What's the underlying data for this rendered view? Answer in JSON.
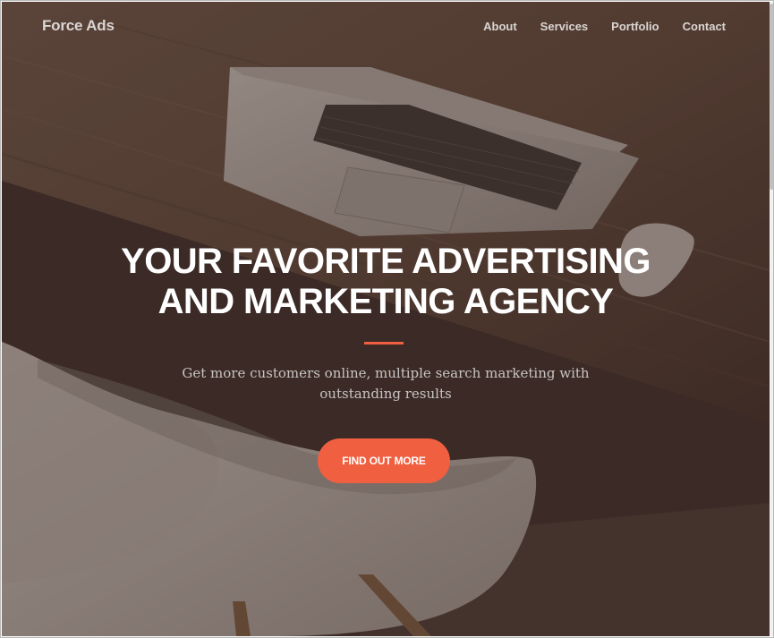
{
  "navbar": {
    "brand": "Force Ads",
    "links": [
      "About",
      "Services",
      "Portfolio",
      "Contact"
    ]
  },
  "hero": {
    "headline_line1": "YOUR FAVORITE ADVERTISING",
    "headline_line2": "AND MARKETING AGENCY",
    "subtitle": "Get more customers online, multiple search marketing with outstanding results",
    "cta_label": "FIND OUT MORE",
    "background_image": "laptop-and-chair-on-wooden-desk"
  },
  "colors": {
    "accent": "#f05f40",
    "overlay": "#3c2a24"
  }
}
